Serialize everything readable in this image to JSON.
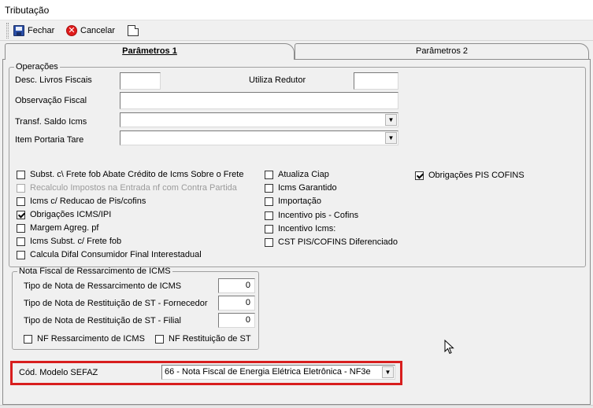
{
  "window": {
    "title": "Tributação"
  },
  "toolbar": {
    "close_label": "Fechar",
    "cancel_label": "Cancelar"
  },
  "tabs": {
    "tab1": "Parâmetros 1",
    "tab2": "Parâmetros 2"
  },
  "operacoes": {
    "legend": "Operações",
    "desc_livros_label": "Desc. Livros Fiscais",
    "desc_livros_value": "",
    "utiliza_redutor_label": "Utiliza Redutor",
    "utiliza_redutor_value": "",
    "observacao_label": "Observação Fiscal",
    "observacao_value": "",
    "transf_saldo_label": "Transf. Saldo Icms",
    "transf_saldo_value": "",
    "item_portaria_label": "Item Portaria Tare",
    "item_portaria_value": ""
  },
  "checks_col1": [
    {
      "label": "Subst. c\\ Frete fob Abate Crédito de Icms Sobre o Frete",
      "checked": false,
      "disabled": false
    },
    {
      "label": "Recalculo Impostos na Entrada nf com Contra Partida",
      "checked": false,
      "disabled": true
    },
    {
      "label": "Icms c/ Reducao de Pis/cofins",
      "checked": false,
      "disabled": false
    },
    {
      "label": "Obrigações ICMS/IPI",
      "checked": true,
      "disabled": false
    },
    {
      "label": "Margem Agreg. pf",
      "checked": false,
      "disabled": false
    },
    {
      "label": "Icms Subst. c/ Frete fob",
      "checked": false,
      "disabled": false
    },
    {
      "label": "Calcula Difal Consumidor Final Interestadual",
      "checked": false,
      "disabled": false
    }
  ],
  "checks_col2": [
    {
      "label": "Atualiza Ciap",
      "checked": false
    },
    {
      "label": "Icms Garantido",
      "checked": false
    },
    {
      "label": "Importação",
      "checked": false
    },
    {
      "label": "Incentivo pis - Cofins",
      "checked": false
    },
    {
      "label": "Incentivo Icms:",
      "checked": false
    },
    {
      "label": "CST PIS/COFINS Diferenciado",
      "checked": false
    }
  ],
  "checks_col3": [
    {
      "label": "Obrigações PIS COFINS",
      "checked": true
    }
  ],
  "ressarcimento": {
    "legend": "Nota Fiscal de Ressarcimento de ICMS",
    "rows": [
      {
        "label": "Tipo de Nota de Ressarcimento de ICMS",
        "value": "0"
      },
      {
        "label": "Tipo de Nota de Restituição de ST - Fornecedor",
        "value": "0"
      },
      {
        "label": "Tipo de Nota de Restituição de ST - Filial",
        "value": "0"
      }
    ],
    "nf_ressarcimento_label": "NF Ressarcimento de ICMS",
    "nf_restituicao_label": "NF Restituição de ST"
  },
  "sefaz": {
    "label": "Cód. Modelo SEFAZ",
    "value": "66 - Nota Fiscal de Energia Elétrica Eletrônica - NF3e",
    "highlight_color": "#d81e1e"
  }
}
